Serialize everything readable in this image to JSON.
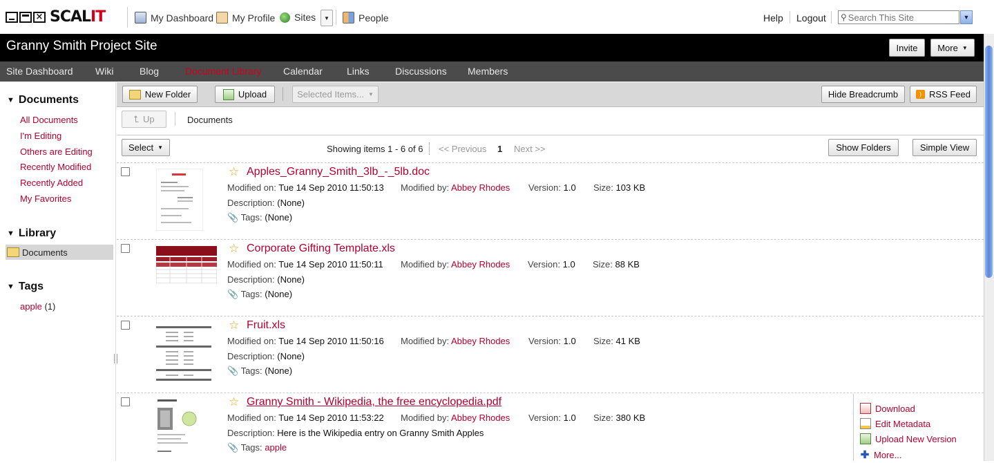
{
  "header": {
    "logo_text": "SCAL",
    "logo_accent": "IT",
    "nav": [
      {
        "label": "My Dashboard",
        "icon": "dashboard-icon"
      },
      {
        "label": "My Profile",
        "icon": "profile-icon"
      },
      {
        "label": "Sites",
        "icon": "sites-globe-icon"
      },
      {
        "label": "People",
        "icon": "people-icon"
      }
    ],
    "help": "Help",
    "logout": "Logout",
    "search_placeholder": "Search This Site"
  },
  "site": {
    "title": "Granny Smith Project Site",
    "invite": "Invite",
    "more": "More"
  },
  "site_nav": [
    {
      "label": "Site Dashboard",
      "active": false
    },
    {
      "label": "Wiki",
      "active": false
    },
    {
      "label": "Blog",
      "active": false
    },
    {
      "label": "Document Library",
      "active": true
    },
    {
      "label": "Calendar",
      "active": false
    },
    {
      "label": "Links",
      "active": false
    },
    {
      "label": "Discussions",
      "active": false
    },
    {
      "label": "Members",
      "active": false
    }
  ],
  "sidebar": {
    "documents_heading": "Documents",
    "filters": [
      "All Documents",
      "I'm Editing",
      "Others are Editing",
      "Recently Modified",
      "Recently Added",
      "My Favorites"
    ],
    "library_heading": "Library",
    "library_folder": "Documents",
    "tags_heading": "Tags",
    "tag_name": "apple",
    "tag_count": "(1)"
  },
  "toolbar": {
    "new_folder": "New Folder",
    "upload": "Upload",
    "selected_items": "Selected Items...",
    "hide_breadcrumb": "Hide Breadcrumb",
    "rss_feed": "RSS Feed"
  },
  "breadcrumb": {
    "up": "Up",
    "path": "Documents"
  },
  "list_controls": {
    "select": "Select",
    "showing": "Showing items 1 - 6 of 6",
    "previous": "<< Previous",
    "page": "1",
    "next": "Next >>",
    "show_folders": "Show Folders",
    "simple_view": "Simple View"
  },
  "labels": {
    "modified_on": "Modified on:",
    "modified_by": "Modified by:",
    "version": "Version:",
    "size": "Size:",
    "description": "Description:",
    "tags": "Tags:"
  },
  "documents": [
    {
      "name": "Apples_Granny_Smith_3lb_-_5lb.doc",
      "modified_on": "Tue 14 Sep 2010 11:50:13",
      "modified_by": "Abbey Rhodes",
      "version": "1.0",
      "size": "103 KB",
      "description": "(None)",
      "tags": "(None)"
    },
    {
      "name": "Corporate Gifting Template.xls",
      "modified_on": "Tue 14 Sep 2010 11:50:11",
      "modified_by": "Abbey Rhodes",
      "version": "1.0",
      "size": "88 KB",
      "description": "(None)",
      "tags": "(None)"
    },
    {
      "name": "Fruit.xls",
      "modified_on": "Tue 14 Sep 2010 11:50:16",
      "modified_by": "Abbey Rhodes",
      "version": "1.0",
      "size": "41 KB",
      "description": "(None)",
      "tags": "(None)"
    },
    {
      "name": "Granny Smith - Wikipedia, the free encyclopedia.pdf",
      "modified_on": "Tue 14 Sep 2010 11:53:22",
      "modified_by": "Abbey Rhodes",
      "version": "1.0",
      "size": "380 KB",
      "description": "Here is the Wikipedia entry on Granny Smith Apples",
      "tags": "apple"
    }
  ],
  "actions": [
    "Download",
    "Edit Metadata",
    "Upload New Version",
    "More..."
  ],
  "colors": {
    "accent": "#b5002e",
    "nav_bg": "#4b4b4b",
    "title_bg": "#000000"
  }
}
